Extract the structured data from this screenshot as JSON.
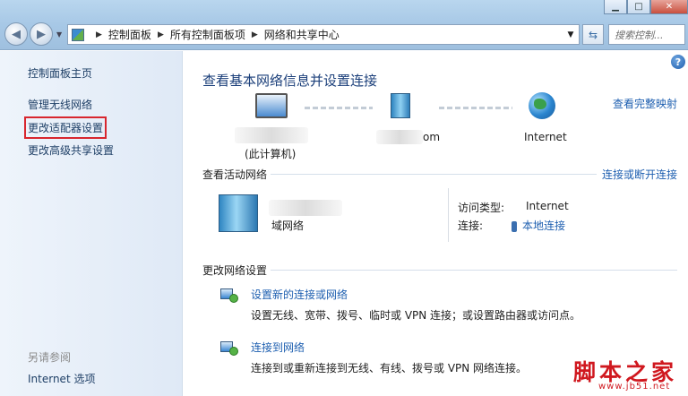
{
  "address": {
    "crumbs": [
      "控制面板",
      "所有控制面板项",
      "网络和共享中心"
    ],
    "search_placeholder": "搜索控制..."
  },
  "left_panel": {
    "home": "控制面板主页",
    "items": [
      "管理无线网络",
      "更改适配器设置",
      "更改高级共享设置"
    ],
    "see_also_heading": "另请参阅",
    "see_also_items": [
      "Internet 选项"
    ]
  },
  "main": {
    "title": "查看基本网络信息并设置连接",
    "see_full_map": "查看完整映射",
    "map": {
      "computer_label": "(此计算机)",
      "middle_label": "om",
      "internet_label": "Internet"
    },
    "active_networks": {
      "heading": "查看活动网络",
      "connect_link": "连接或断开连接",
      "network_type": "域网络",
      "access_type_label": "访问类型:",
      "access_type_value": "Internet",
      "connection_label": "连接:",
      "connection_value": "本地连接"
    },
    "change_settings": {
      "heading": "更改网络设置",
      "tasks": [
        {
          "title": "设置新的连接或网络",
          "desc": "设置无线、宽带、拨号、临时或 VPN 连接；或设置路由器或访问点。"
        },
        {
          "title": "连接到网络",
          "desc": "连接到或重新连接到无线、有线、拨号或 VPN 网络连接。"
        }
      ]
    }
  },
  "watermark": {
    "text": "脚本之家",
    "url": "www.jb51.net"
  },
  "colors": {
    "link": "#1e5fb0",
    "highlight_box": "#d8262e",
    "title": "#1b3f7a"
  }
}
